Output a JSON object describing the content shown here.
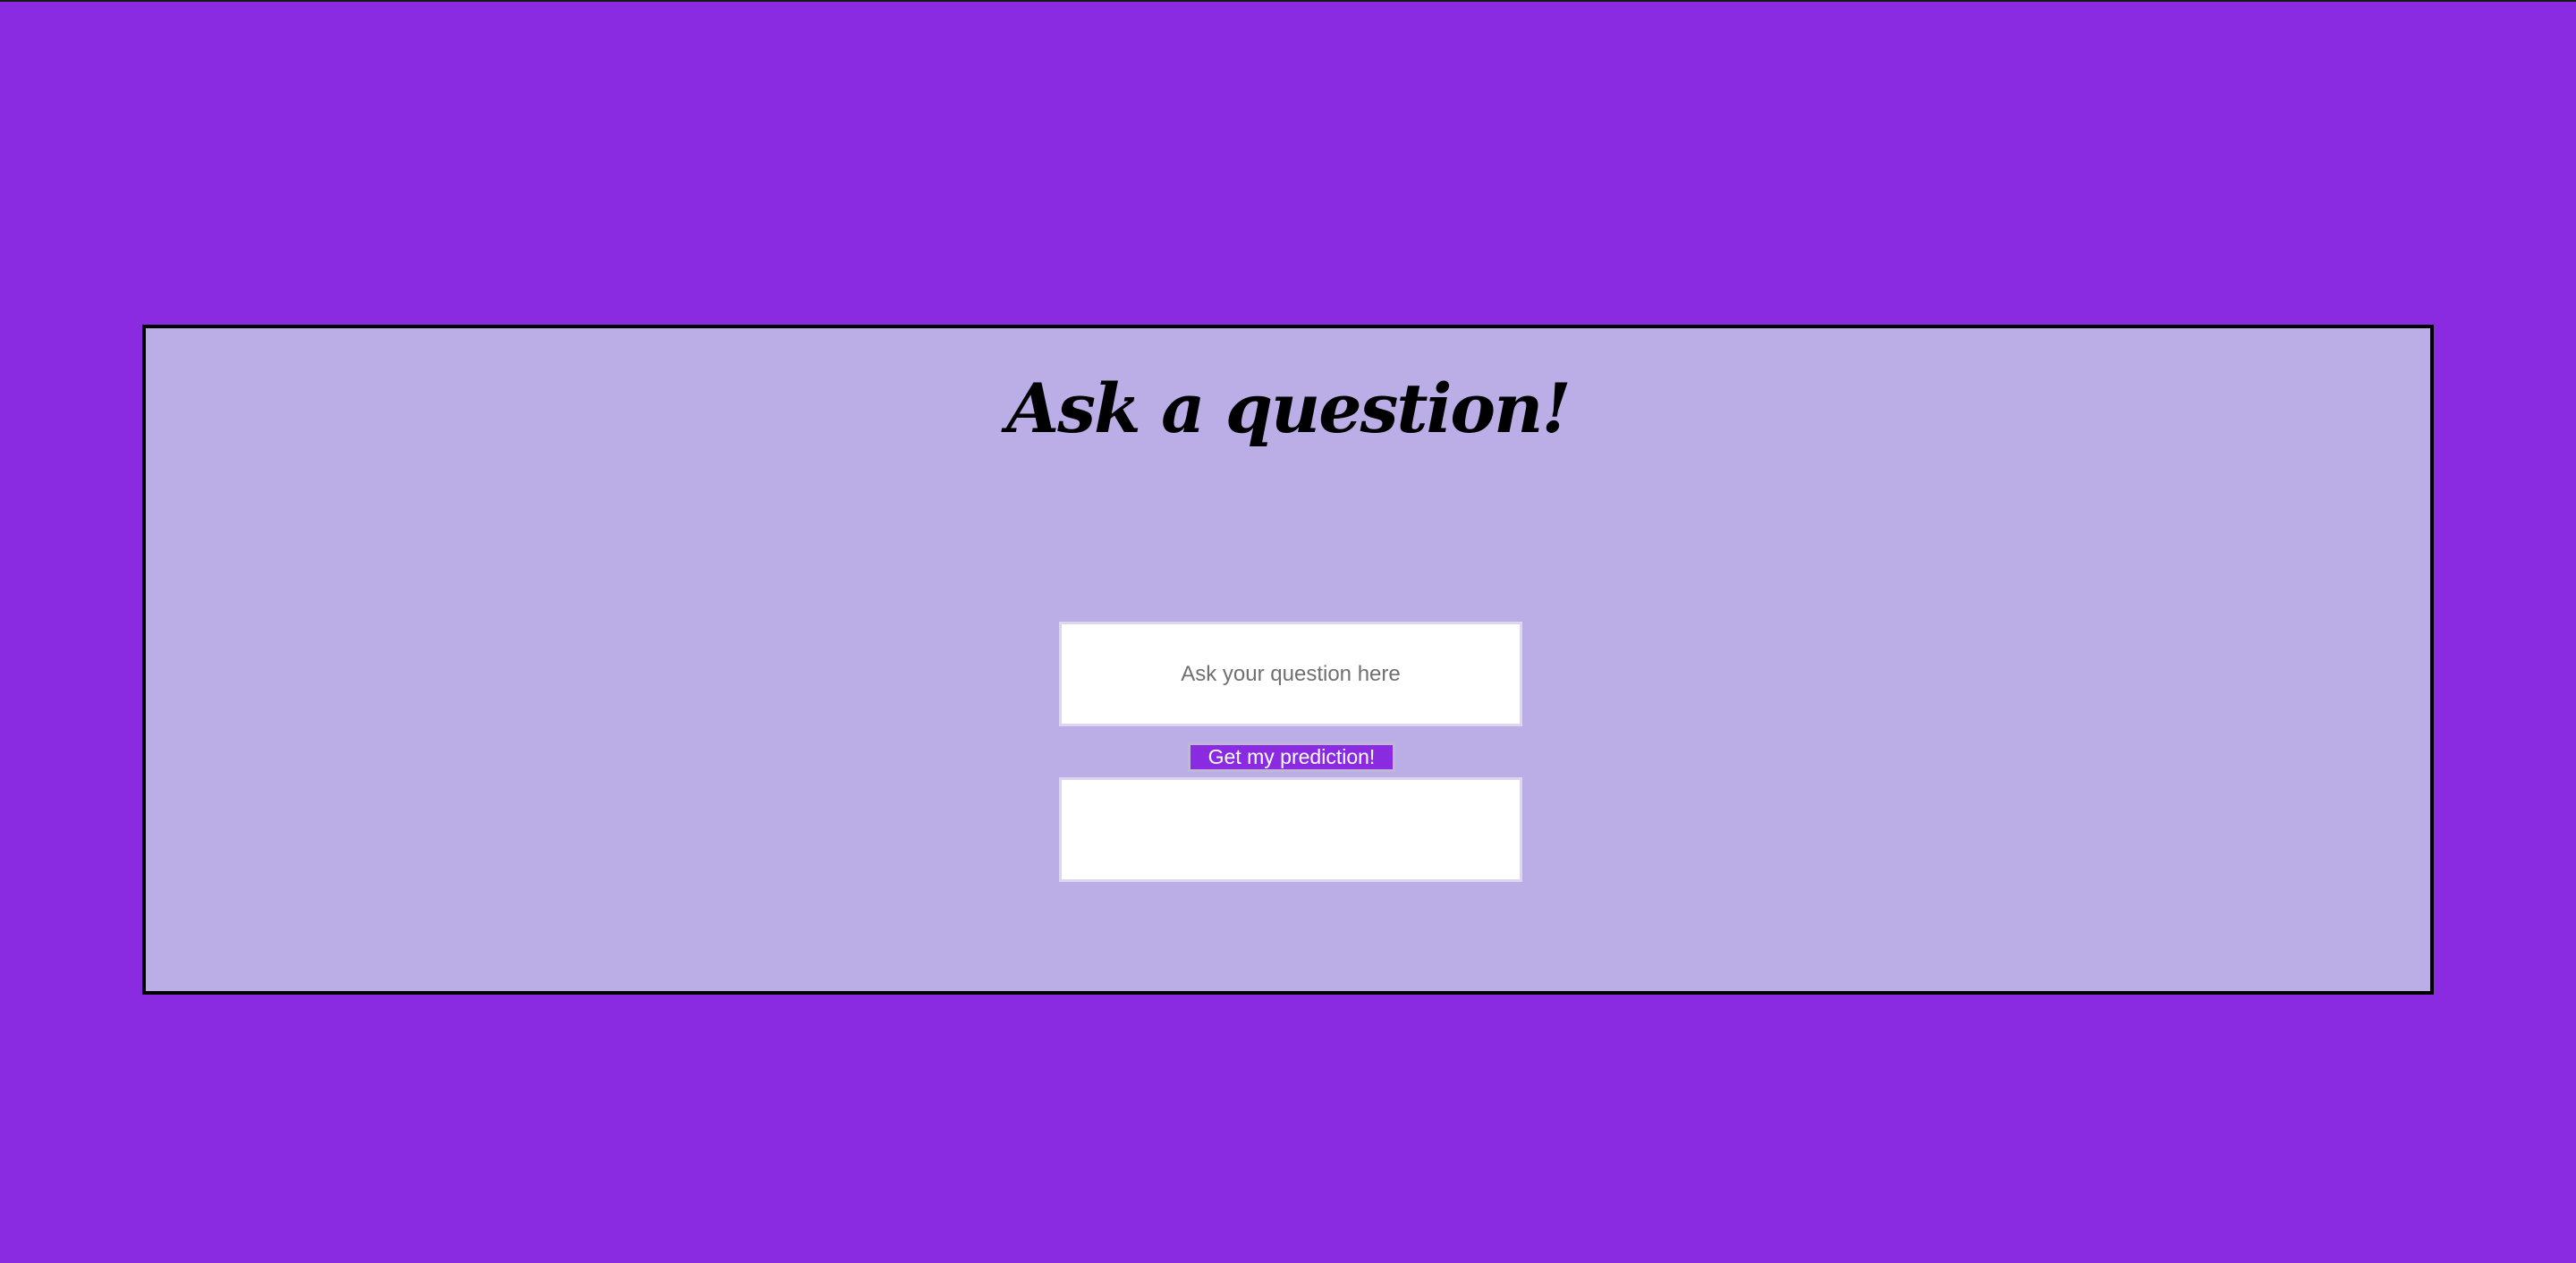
{
  "page": {
    "title": "Ask a question!"
  },
  "question": {
    "placeholder": "Ask your question here",
    "value": ""
  },
  "predict_button": {
    "label": "Get my prediction!"
  },
  "answer": {
    "text": ""
  },
  "colors": {
    "background": "#8a2be2",
    "panel": "#bbaee6",
    "panel_border": "#000000",
    "button_bg": "#8a2be2",
    "button_text": "#ffffff",
    "input_bg": "#ffffff"
  }
}
